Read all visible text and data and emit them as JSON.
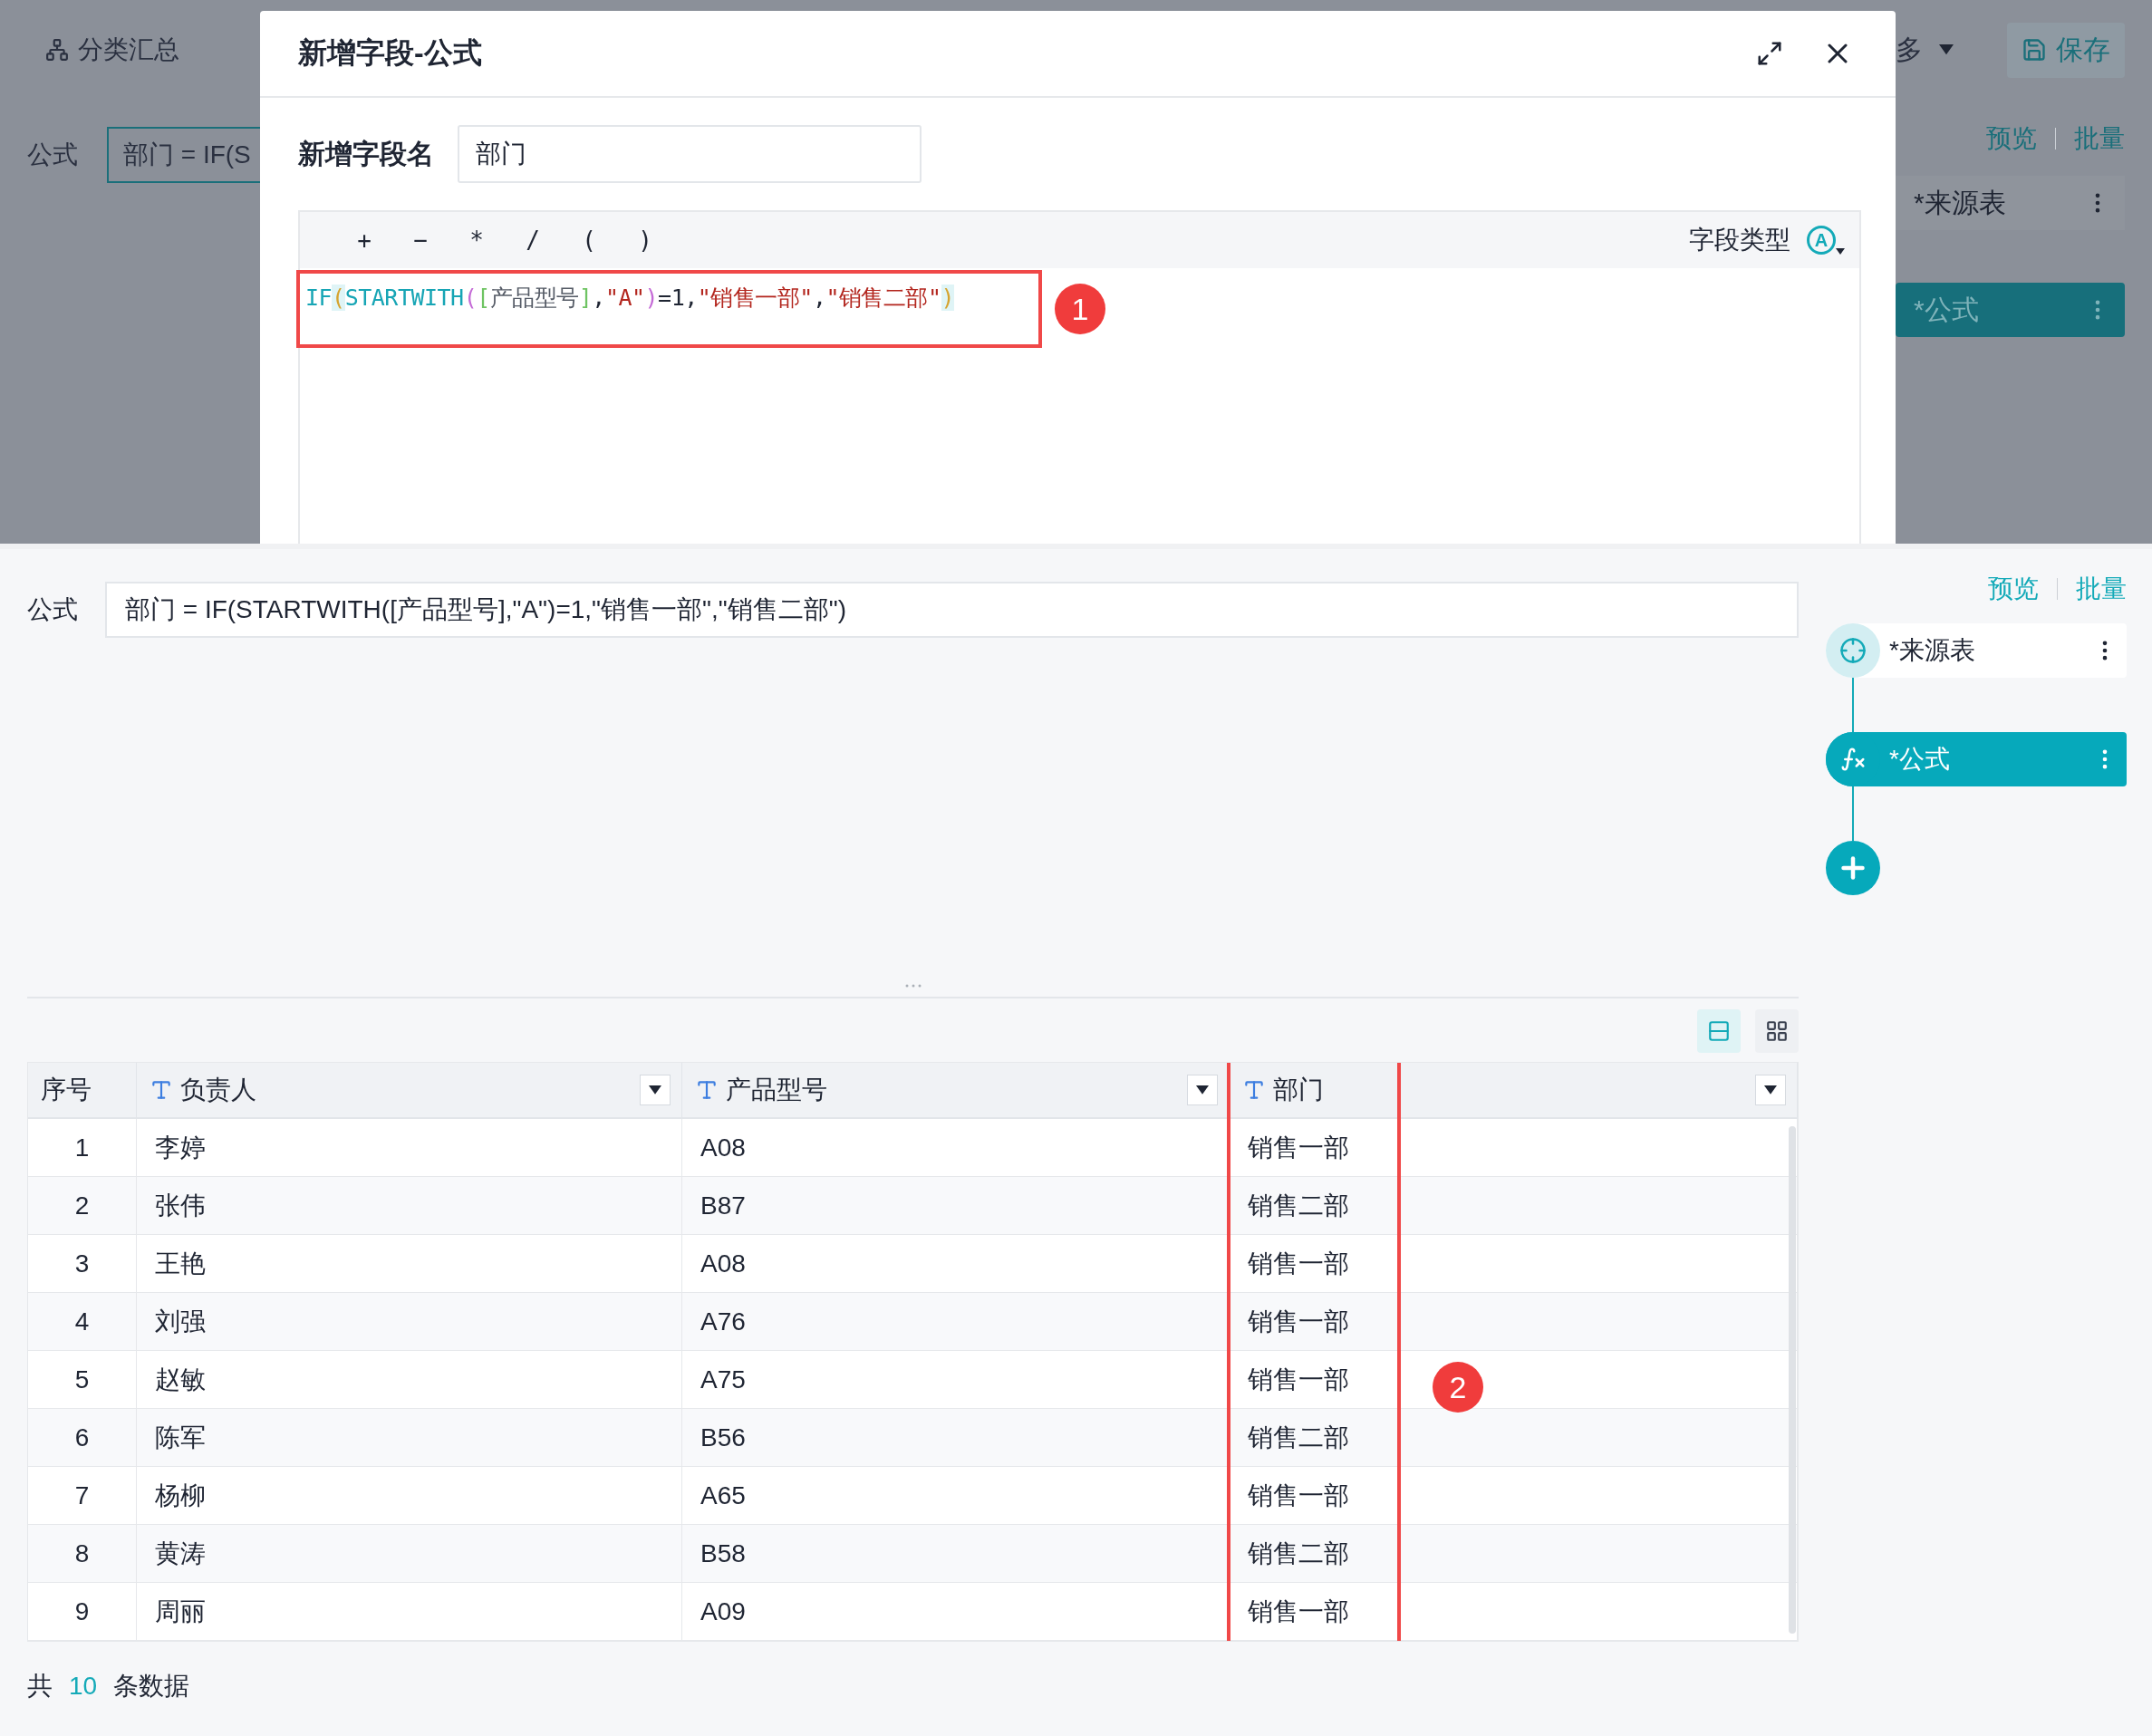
{
  "background": {
    "toolbar_item": "分类汇总",
    "more": "多",
    "save_button": "保存",
    "formula_label": "公式",
    "formula_value": "部门 = IF(S",
    "preview_link": "预览",
    "batch_link": "批量",
    "nodes": [
      {
        "label": "*来源表",
        "selected": false
      },
      {
        "label": "*公式",
        "selected": true
      }
    ]
  },
  "dialog": {
    "title": "新增字段-公式",
    "name_label": "新增字段名",
    "name_value": "部门",
    "operators": [
      "+",
      "−",
      "*",
      "/",
      "(",
      ")"
    ],
    "field_type_label": "字段类型",
    "field_type_icon": "A",
    "code_tokens": [
      {
        "text": "IF",
        "kind": "function"
      },
      {
        "text": "(",
        "kind": "paren_outer"
      },
      {
        "text": "STARTWITH",
        "kind": "function"
      },
      {
        "text": "(",
        "kind": "paren_inner"
      },
      {
        "text": "[",
        "kind": "bracket"
      },
      {
        "text": "产品型号",
        "kind": "field"
      },
      {
        "text": "]",
        "kind": "bracket"
      },
      {
        "text": ",",
        "kind": "plain"
      },
      {
        "text": "\"A\"",
        "kind": "string"
      },
      {
        "text": ")",
        "kind": "paren_inner"
      },
      {
        "text": "=1,",
        "kind": "plain"
      },
      {
        "text": "\"销售一部\"",
        "kind": "string"
      },
      {
        "text": ",",
        "kind": "plain"
      },
      {
        "text": "\"销售二部\"",
        "kind": "string"
      },
      {
        "text": ")",
        "kind": "paren_outer"
      }
    ],
    "annotation": "1"
  },
  "formula": {
    "label": "公式",
    "value": "部门 = IF(STARTWITH([产品型号],\"A\")=1,\"销售一部\",\"销售二部\")"
  },
  "flow": {
    "preview_link": "预览",
    "batch_link": "批量",
    "nodes": [
      {
        "kind": "source",
        "label": "*来源表",
        "selected": false
      },
      {
        "kind": "formula",
        "label": "*公式",
        "selected": true
      }
    ]
  },
  "view_toggles": [
    {
      "kind": "list",
      "selected": true
    },
    {
      "kind": "grid",
      "selected": false
    }
  ],
  "table": {
    "columns": [
      {
        "label": "序号",
        "typed": false
      },
      {
        "label": "负责人",
        "typed": true
      },
      {
        "label": "产品型号",
        "typed": true
      },
      {
        "label": "部门",
        "typed": true
      }
    ],
    "rows": [
      [
        "1",
        "李婷",
        "A08",
        "销售一部"
      ],
      [
        "2",
        "张伟",
        "B87",
        "销售二部"
      ],
      [
        "3",
        "王艳",
        "A08",
        "销售一部"
      ],
      [
        "4",
        "刘强",
        "A76",
        "销售一部"
      ],
      [
        "5",
        "赵敏",
        "A75",
        "销售一部"
      ],
      [
        "6",
        "陈军",
        "B56",
        "销售二部"
      ],
      [
        "7",
        "杨柳",
        "A65",
        "销售一部"
      ],
      [
        "8",
        "黄涛",
        "B58",
        "销售二部"
      ],
      [
        "9",
        "周丽",
        "A09",
        "销售一部"
      ]
    ],
    "annotation": "2"
  },
  "footer": {
    "prefix": "共",
    "count": "10",
    "suffix": "条数据"
  }
}
